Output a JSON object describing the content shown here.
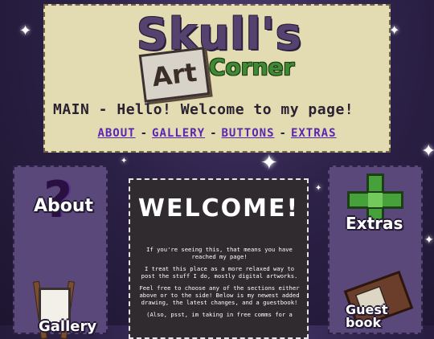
{
  "header": {
    "logo": {
      "title": "Skull's",
      "art": "Art",
      "corner": "Corner"
    },
    "welcome": "MAIN - Hello! Welcome to my page!",
    "nav": [
      "ABOUT",
      "GALLERY",
      "BUTTONS",
      "EXTRAS"
    ],
    "separator": "-"
  },
  "sidebar_left": {
    "about_label": "About",
    "gallery_label": "Gallery"
  },
  "sidebar_right": {
    "extras_label": "Extras",
    "guestbook_label": "Guest book"
  },
  "main": {
    "title": "WELCOME!",
    "paragraphs": [
      "If you're seeing this, that means you have reached my page!",
      "I treat this place as a more relaxed way to post the stuff I do, mostly digital artworks.",
      "Feel free to choose any of the sections either above or to the side! Below is my newest added drawing, the latest changes, and a guestbook!",
      "(Also, psst, im taking in free comms for a"
    ]
  },
  "colors": {
    "background": "#2c2147",
    "header_bg": "#e3dbb2",
    "nav_link": "#5a25b0",
    "panel_bg": "#5b487a",
    "center_bg": "#2f2b2f",
    "logo_purple": "#55426f",
    "logo_green": "#3f8a33"
  }
}
